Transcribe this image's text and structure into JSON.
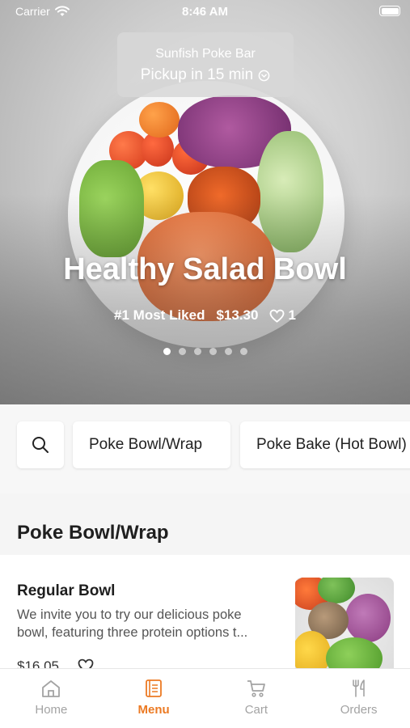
{
  "status_bar": {
    "carrier": "Carrier",
    "time": "8:46 AM"
  },
  "hero": {
    "store_name": "Sunfish Poke Bar",
    "pickup_eta": "Pickup in 15 min",
    "title": "Healthy Salad Bowl",
    "tag": "#1 Most Liked",
    "price": "$13.30",
    "likes": "1",
    "slides_total": 6,
    "slide_active": 1
  },
  "categories": {
    "search_icon": "search-icon",
    "items": [
      "Poke Bowl/Wrap",
      "Poke Bake (Hot Bowl)"
    ]
  },
  "section": {
    "title": "Poke Bowl/Wrap"
  },
  "items": [
    {
      "name": "Regular Bowl",
      "description_line1": "We invite you to try our delicious poke",
      "description_line2": "bowl, featuring three protein options t...",
      "price": "$16.05"
    }
  ],
  "tabbar": {
    "tabs": [
      {
        "label": "Home",
        "icon": "home-icon"
      },
      {
        "label": "Menu",
        "icon": "menu-icon"
      },
      {
        "label": "Cart",
        "icon": "cart-icon"
      },
      {
        "label": "Orders",
        "icon": "orders-icon"
      }
    ],
    "active": "Menu"
  },
  "colors": {
    "accent": "#ec7a23",
    "inactive": "#a3a3a3"
  }
}
